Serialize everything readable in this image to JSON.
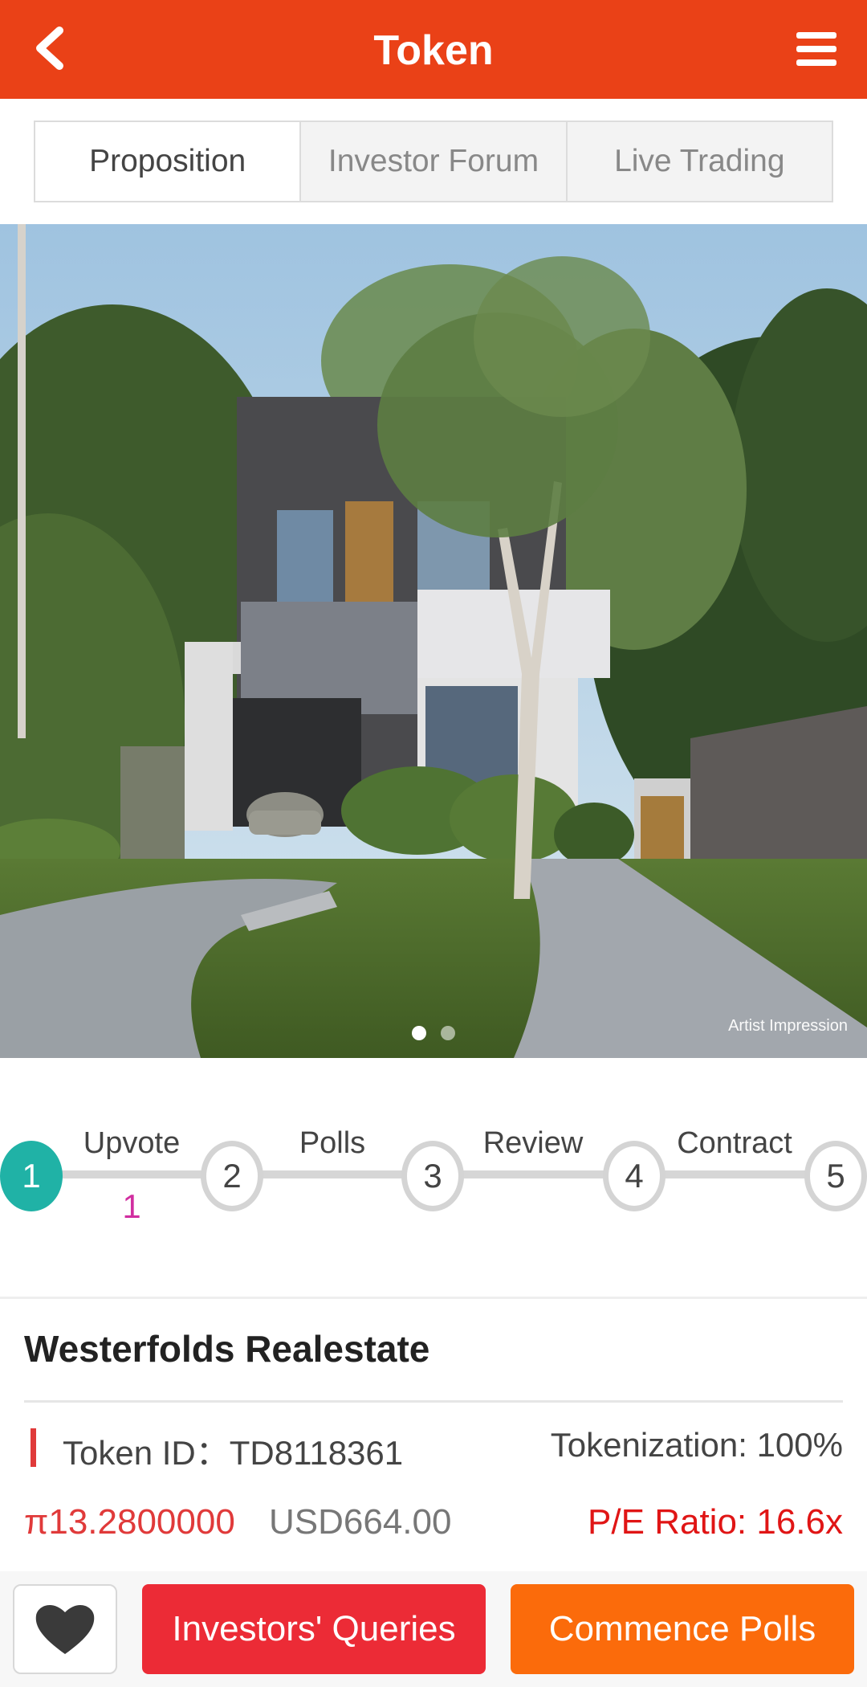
{
  "header": {
    "title": "Token",
    "back_icon": "chevron-left-icon",
    "menu_icon": "hamburger-menu-icon",
    "background_color": "#ea4117"
  },
  "tabs": [
    {
      "label": "Proposition",
      "active": true
    },
    {
      "label": "Investor Forum",
      "active": false
    },
    {
      "label": "Live Trading",
      "active": false
    }
  ],
  "hero": {
    "caption": "Artist Impression",
    "slide_count": 2,
    "active_slide": 1
  },
  "steps": [
    {
      "number": "1",
      "label": "Upvote",
      "count": "1",
      "active": true
    },
    {
      "number": "2",
      "label": "Polls",
      "active": false
    },
    {
      "number": "3",
      "label": "Review",
      "active": false
    },
    {
      "number": "4",
      "label": "Contract",
      "active": false
    },
    {
      "number": "5",
      "active": false
    }
  ],
  "property": {
    "name": "Westerfolds Realestate",
    "token_id": "Token ID：TD8118361",
    "tokenization": "Tokenization: 100%",
    "price_pi": "π13.2800000",
    "price_usd": "USD664.00",
    "pe_ratio": "P/E Ratio: 16.6x"
  },
  "actions": {
    "favorite_icon": "heart-icon",
    "queries_label": "Investors' Queries",
    "polls_label": "Commence Polls",
    "queries_color": "#ec2b36",
    "polls_color": "#fb6b0b"
  }
}
